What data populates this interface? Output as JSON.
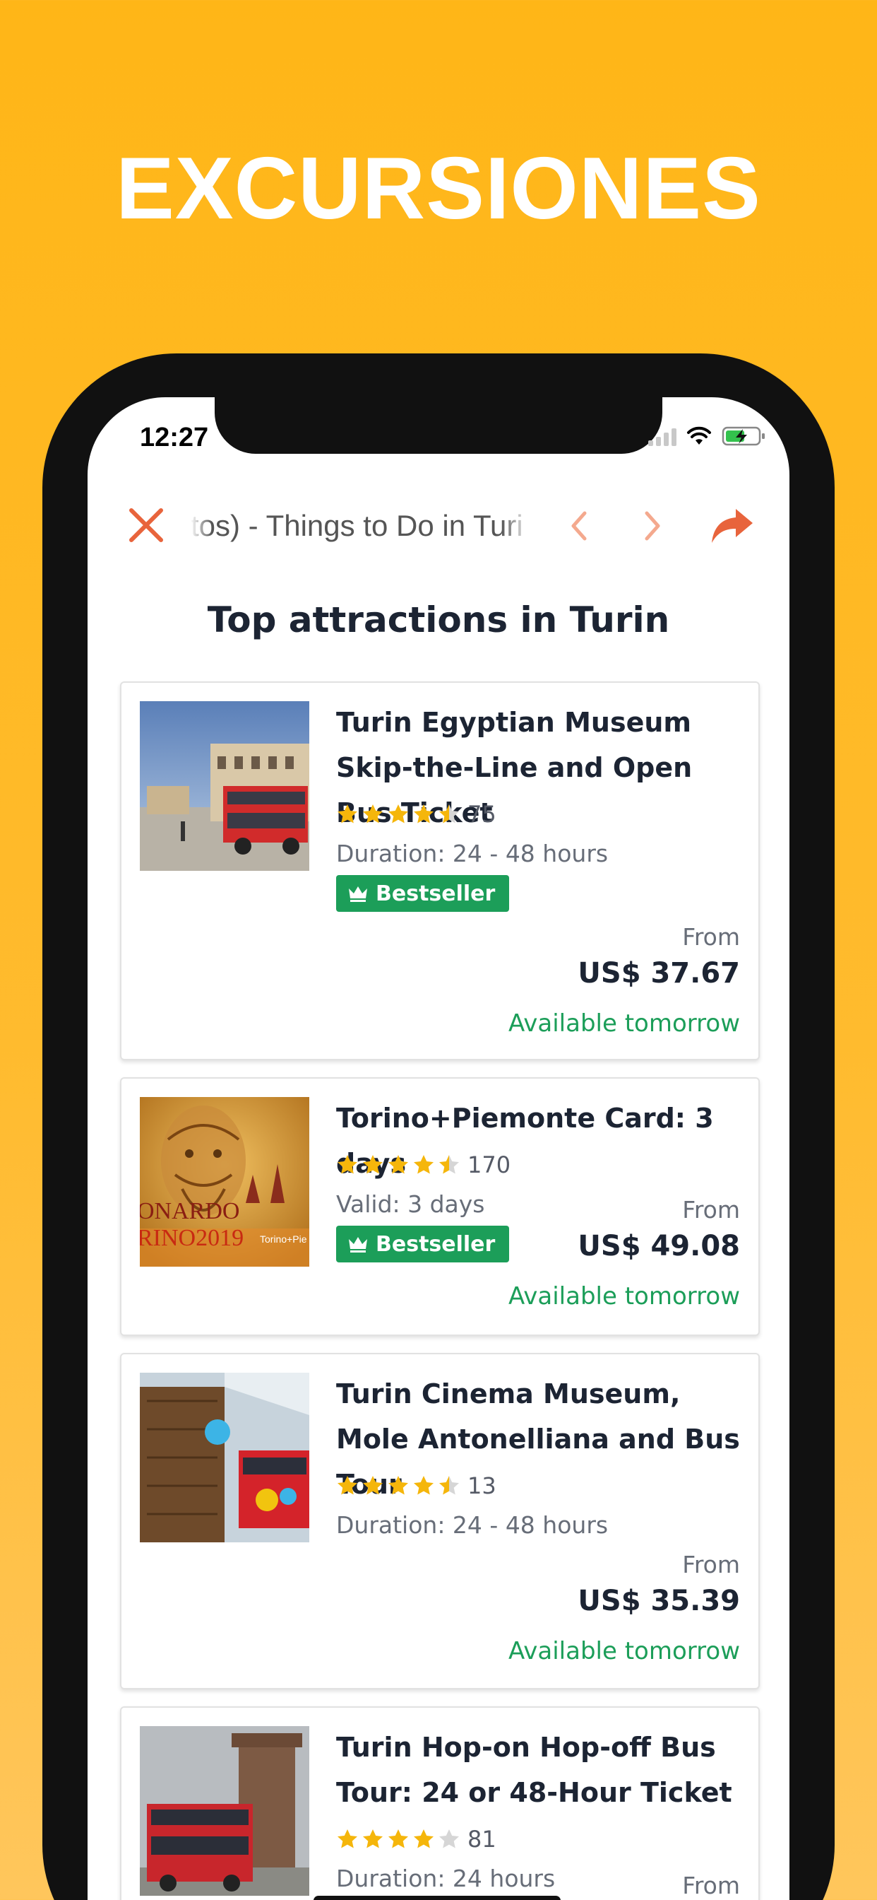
{
  "headline": "EXCURSIONES",
  "status_bar": {
    "time": "12:27"
  },
  "browser_bar": {
    "title": "tos) - Things to Do in Turi",
    "icons": [
      "close-icon",
      "back-chevron-icon",
      "forward-chevron-icon",
      "share-icon"
    ]
  },
  "page": {
    "section_title": "Top attractions in Turin",
    "cards": [
      {
        "title": "Turin Egyptian Museum Skip-the-Line and Open Bus Ticket",
        "rating": 4.5,
        "reviews": "75",
        "meta": "Duration: 24 - 48 hours",
        "badge": "Bestseller",
        "from_label": "From",
        "price": "US$ 37.67",
        "availability": "Available tomorrow"
      },
      {
        "title": "Torino+Piemonte Card: 3 days",
        "rating": 4.5,
        "reviews": "170",
        "meta": "Valid: 3 days",
        "badge": "Bestseller",
        "from_label": "From",
        "price": "US$ 49.08",
        "availability": "Available tomorrow",
        "image_text": "ONARDO RINO2019 Torino+Pie"
      },
      {
        "title": "Turin Cinema Museum, Mole Antonelliana and Bus Tour",
        "rating": 4.5,
        "reviews": "13",
        "meta": "Duration: 24 - 48 hours",
        "from_label": "From",
        "price": "US$ 35.39",
        "availability": "Available tomorrow"
      },
      {
        "title": "Turin Hop-on Hop-off Bus Tour: 24 or 48-Hour Ticket",
        "rating": 4,
        "reviews": "81",
        "meta": "Duration: 24 hours",
        "from_label": "From"
      }
    ]
  },
  "colors": {
    "background": "#FFB617",
    "accent": "#E8643C",
    "bestseller": "#1C9E59",
    "availability": "#1C9E59",
    "star": "#F5B60B",
    "text_primary": "#1C2433"
  }
}
